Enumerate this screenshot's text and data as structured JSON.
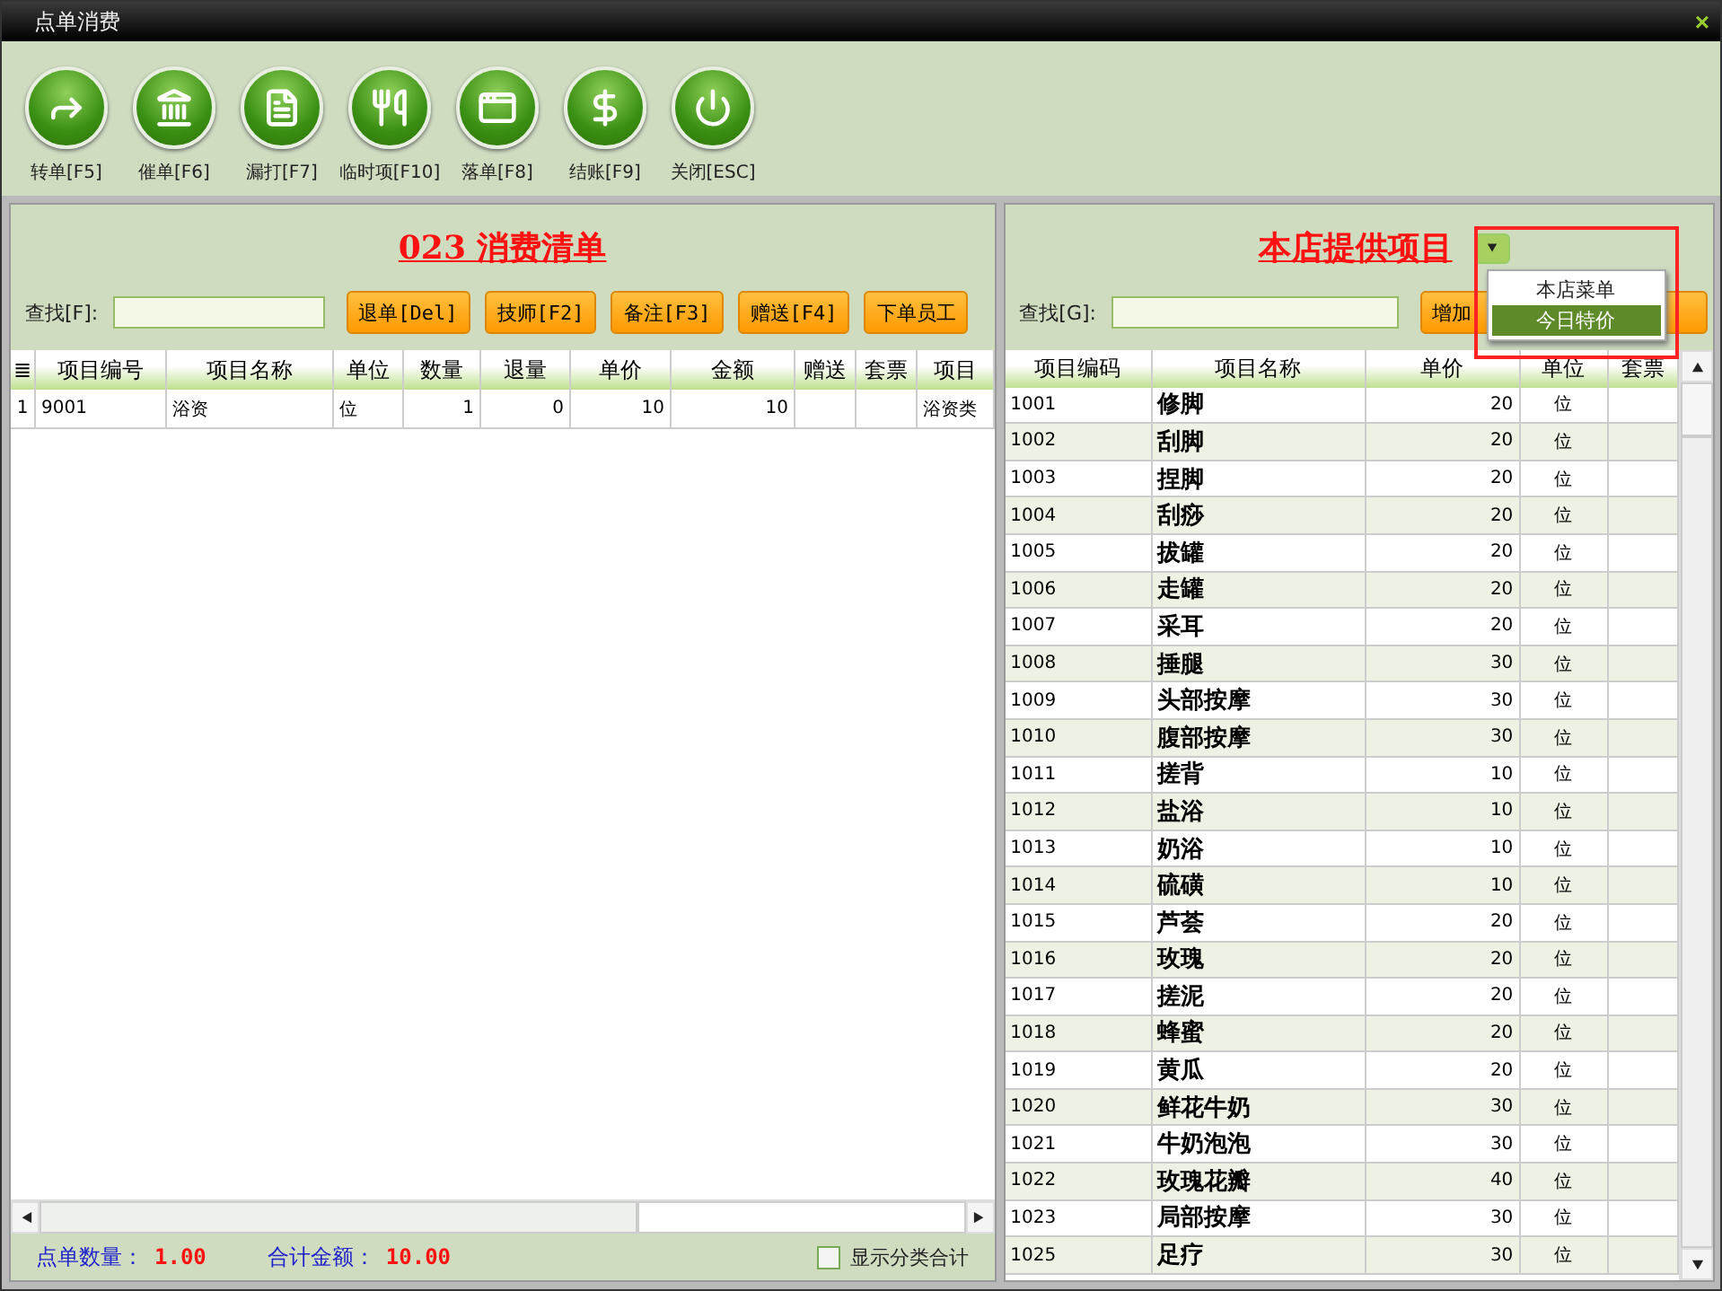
{
  "window": {
    "title": "点单消费",
    "close": "×"
  },
  "toolbar": [
    {
      "kind": "forward",
      "label": "转单[F5]"
    },
    {
      "kind": "bank",
      "label": "催单[F6]"
    },
    {
      "kind": "document",
      "label": "漏打[F7]"
    },
    {
      "kind": "utensils",
      "label": "临时项[F10]"
    },
    {
      "kind": "screen",
      "label": "落单[F8]"
    },
    {
      "kind": "dollar",
      "label": "结账[F9]"
    },
    {
      "kind": "power",
      "label": "关闭[ESC]"
    }
  ],
  "order_panel": {
    "title": "023  消费清单",
    "search_label": "查找[F]:",
    "buttons": [
      "退单[Del]",
      "技师[F2]",
      "备注[F3]",
      "赠送[F4]",
      "下单员工"
    ],
    "columns": [
      "≣",
      "项目编号",
      "项目名称",
      "单位",
      "数量",
      "退量",
      "单价",
      "金额",
      "赠送",
      "套票",
      "项目"
    ],
    "rows": [
      [
        "1",
        "9001",
        "浴资",
        "位",
        "1",
        "0",
        "10",
        "10",
        "",
        "",
        "浴资类"
      ]
    ],
    "footer": {
      "count_label": "点单数量：",
      "count": "1.00",
      "total_label": "合计金额：",
      "total": "10.00",
      "show_category_totals": {
        "label": "显示分类合计",
        "checked": false
      }
    }
  },
  "items_panel": {
    "title": "本店提供项目",
    "dropdown": {
      "expanded": true,
      "options": [
        {
          "label": "本店菜单",
          "selected": false
        },
        {
          "label": "今日特价",
          "selected": true
        }
      ]
    },
    "search_label": "查找[G]:",
    "add_button": "增加",
    "columns": [
      "项目编码",
      "项目名称",
      "单价",
      "单位",
      "套票"
    ],
    "rows": [
      [
        "1001",
        "修脚",
        "20",
        "位",
        ""
      ],
      [
        "1002",
        "刮脚",
        "20",
        "位",
        ""
      ],
      [
        "1003",
        "捏脚",
        "20",
        "位",
        ""
      ],
      [
        "1004",
        "刮痧",
        "20",
        "位",
        ""
      ],
      [
        "1005",
        "拔罐",
        "20",
        "位",
        ""
      ],
      [
        "1006",
        "走罐",
        "20",
        "位",
        ""
      ],
      [
        "1007",
        "采耳",
        "20",
        "位",
        ""
      ],
      [
        "1008",
        "捶腿",
        "30",
        "位",
        ""
      ],
      [
        "1009",
        "头部按摩",
        "30",
        "位",
        ""
      ],
      [
        "1010",
        "腹部按摩",
        "30",
        "位",
        ""
      ],
      [
        "1011",
        "搓背",
        "10",
        "位",
        ""
      ],
      [
        "1012",
        "盐浴",
        "10",
        "位",
        ""
      ],
      [
        "1013",
        "奶浴",
        "10",
        "位",
        ""
      ],
      [
        "1014",
        "硫磺",
        "10",
        "位",
        ""
      ],
      [
        "1015",
        "芦荟",
        "20",
        "位",
        ""
      ],
      [
        "1016",
        "玫瑰",
        "20",
        "位",
        ""
      ],
      [
        "1017",
        "搓泥",
        "20",
        "位",
        ""
      ],
      [
        "1018",
        "蜂蜜",
        "20",
        "位",
        ""
      ],
      [
        "1019",
        "黄瓜",
        "20",
        "位",
        ""
      ],
      [
        "1020",
        "鲜花牛奶",
        "30",
        "位",
        ""
      ],
      [
        "1021",
        "牛奶泡泡",
        "30",
        "位",
        ""
      ],
      [
        "1022",
        "玫瑰花瓣",
        "40",
        "位",
        ""
      ],
      [
        "1023",
        "局部按摩",
        "30",
        "位",
        ""
      ],
      [
        "1025",
        "足疗",
        "30",
        "位",
        ""
      ]
    ]
  }
}
